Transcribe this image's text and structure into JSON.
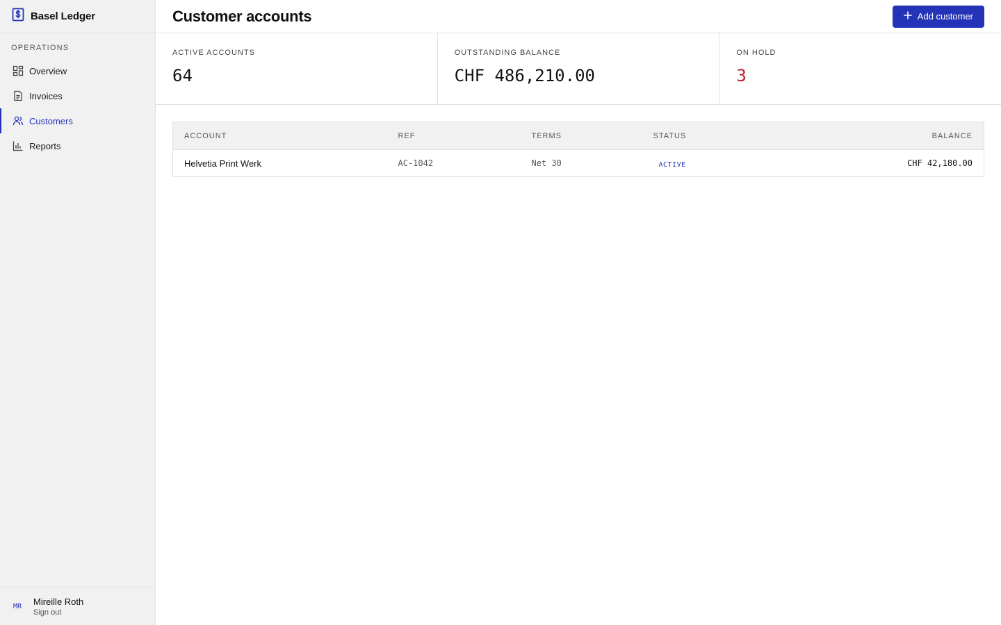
{
  "app": {
    "name": "Basel Ledger",
    "logo_icon": "dollar-document-icon"
  },
  "colors": {
    "accent": "#2334b8",
    "alert": "#b3202a",
    "sidebar_bg": "#f1f1f1"
  },
  "sidebar": {
    "section_label": "OPERATIONS",
    "items": [
      {
        "label": "Overview",
        "icon": "grid-icon",
        "active": false
      },
      {
        "label": "Invoices",
        "icon": "document-icon",
        "active": false
      },
      {
        "label": "Customers",
        "icon": "users-icon",
        "active": true
      },
      {
        "label": "Reports",
        "icon": "bar-chart-icon",
        "active": false
      }
    ],
    "user": {
      "initials": "MR",
      "name": "Mireille Roth",
      "sign_out": "Sign out"
    }
  },
  "header": {
    "title": "Customer accounts",
    "add_button": "Add customer"
  },
  "stats": [
    {
      "label": "ACTIVE ACCOUNTS",
      "value": "64"
    },
    {
      "label": "OUTSTANDING BALANCE",
      "value": "CHF 486,210.00"
    },
    {
      "label": "ON HOLD",
      "value": "3"
    }
  ],
  "table": {
    "columns": [
      "ACCOUNT",
      "REF",
      "TERMS",
      "STATUS",
      "BALANCE"
    ],
    "rows": [
      {
        "account": "Helvetia Print Werk",
        "ref": "AC-1042",
        "terms": "Net 30",
        "status": "ACTIVE",
        "balance": "CHF 42,180.00"
      }
    ]
  }
}
